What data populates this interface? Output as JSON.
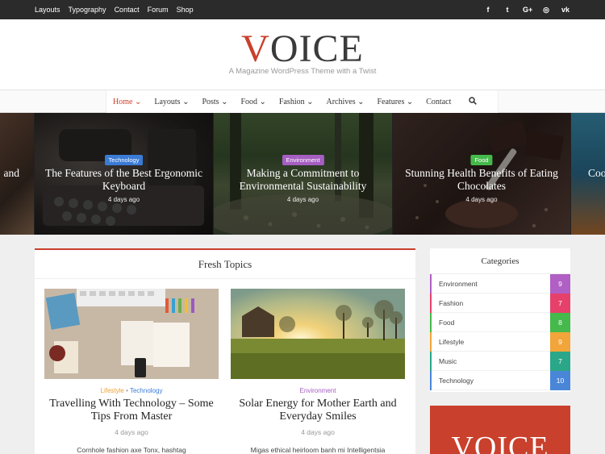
{
  "topbar": {
    "nav": [
      "Layouts",
      "Typography",
      "Contact",
      "Forum",
      "Shop"
    ],
    "social": [
      {
        "icon": "facebook-icon",
        "glyph": "f"
      },
      {
        "icon": "twitter-icon",
        "glyph": "t"
      },
      {
        "icon": "google-plus-icon",
        "glyph": "G+"
      },
      {
        "icon": "instagram-icon",
        "glyph": "◎"
      },
      {
        "icon": "vk-icon",
        "glyph": "vk"
      }
    ]
  },
  "header": {
    "logo_first": "V",
    "logo_rest": "OICE",
    "tagline": "A Magazine WordPress Theme with a Twist"
  },
  "mainnav": {
    "items": [
      "Home",
      "Layouts",
      "Posts",
      "Food",
      "Fashion",
      "Archives",
      "Features",
      "Contact"
    ],
    "has_dropdown": [
      true,
      true,
      true,
      true,
      true,
      true,
      true,
      false
    ],
    "active": "Home",
    "search_icon": "search-icon"
  },
  "slider": {
    "left_edge_text": "and",
    "right_edge_text": "Coo",
    "slides": [
      {
        "category": "Technology",
        "category_color": "#3a7bd5",
        "title": "The Features of the Best Ergonomic Keyboard",
        "date": "4 days ago"
      },
      {
        "category": "Environment",
        "category_color": "#a55ec1",
        "title": "Making a Commitment to Environmental Sustainability",
        "date": "4 days ago"
      },
      {
        "category": "Food",
        "category_color": "#45b94b",
        "title": "Stunning Health Benefits of Eating Chocolates",
        "date": "4 days ago"
      }
    ]
  },
  "fresh": {
    "heading": "Fresh Topics",
    "posts": [
      {
        "cat1": "Lifestyle",
        "cat1_color": "#f0a030",
        "separator": " • ",
        "cat2": "Technology",
        "cat2_color": "#3a7bd5",
        "title": "Travelling With Technology – Some Tips From Master",
        "date": "4 days ago",
        "excerpt": "Cornhole fashion axe Tonx, hashtag"
      },
      {
        "cat1": "Environment",
        "cat1_color": "#a55ec1",
        "title": "Solar Energy for Mother Earth and Everyday Smiles",
        "date": "4 days ago",
        "excerpt": "Migas ethical heirloom banh mi Intelligentsia"
      }
    ]
  },
  "categories": {
    "heading": "Categories",
    "items": [
      {
        "name": "Environment",
        "count": "9",
        "color": "#b05fc4"
      },
      {
        "name": "Fashion",
        "count": "7",
        "color": "#e6416b"
      },
      {
        "name": "Food",
        "count": "8",
        "color": "#45b94b"
      },
      {
        "name": "Lifestyle",
        "count": "9",
        "color": "#f2a53a"
      },
      {
        "name": "Music",
        "count": "7",
        "color": "#2aa788"
      },
      {
        "name": "Technology",
        "count": "10",
        "color": "#4a86d8"
      }
    ]
  },
  "ad": {
    "text": "VOICE"
  },
  "colors": {
    "accent": "#c9402c"
  }
}
